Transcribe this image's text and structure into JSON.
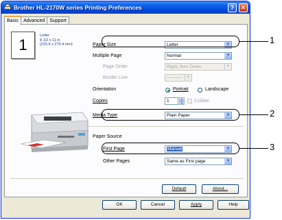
{
  "window": {
    "title": "Brother HL-2170W series Printing Preferences"
  },
  "tabs": [
    {
      "label": "Basic"
    },
    {
      "label": "Advanced"
    },
    {
      "label": "Support"
    }
  ],
  "preview": {
    "page_number": "1",
    "info_lines": [
      "Letter",
      "8 1/2 x 11 in",
      "(215.9 x 279.4 mm)"
    ]
  },
  "settings": {
    "paper_size": {
      "label": "Paper Size",
      "value": "Letter"
    },
    "multiple_page": {
      "label": "Multiple Page",
      "value": "Normal"
    },
    "page_order": {
      "label": "Page Order",
      "value": "Right, then Down"
    },
    "border_line": {
      "label": "Border Line",
      "value": ""
    },
    "orientation": {
      "label": "Orientation",
      "portrait": "Portrait",
      "landscape": "Landscape",
      "selected": "Portrait"
    },
    "copies": {
      "label": "Copies",
      "value": "1",
      "collate": "Collate"
    },
    "media_type": {
      "label": "Media Type",
      "value": "Plain Paper"
    },
    "paper_source": {
      "label": "Paper Source",
      "first_page": {
        "label": "First Page",
        "value": "Manual"
      },
      "other_pages": {
        "label": "Other Pages",
        "value": "Same as First page"
      }
    }
  },
  "buttons": {
    "default": "Default",
    "about": "About...",
    "ok": "OK",
    "cancel": "Cancel",
    "apply": "Apply",
    "help": "Help"
  },
  "callouts": [
    "1",
    "2",
    "3"
  ],
  "colors": {
    "titlebar": "#0a5fe8",
    "selection": "#316ac5",
    "callout": "#000000"
  }
}
